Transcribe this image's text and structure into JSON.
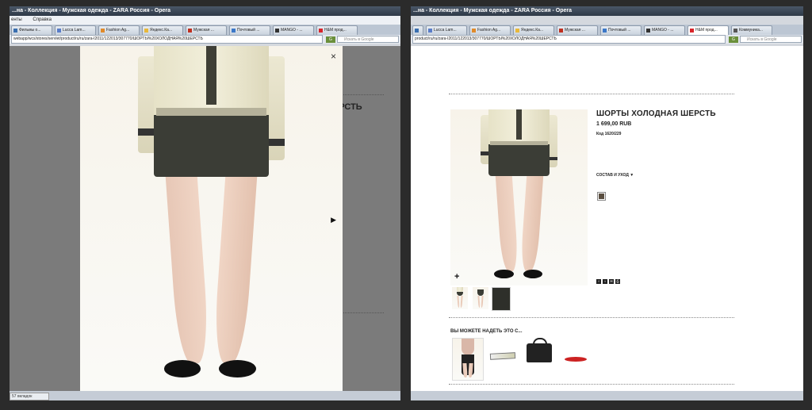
{
  "left_window": {
    "title": "...на - Коллекция - Мужская одежда - ZARA Россия - Opera",
    "menu": [
      "енты",
      "Справка"
    ],
    "tabs": [
      "Фильмы о...",
      "Lucca Lam...",
      "Fashion Ag...",
      "Яндекс.Ка...",
      "Мужская ...",
      "Почтовый ...",
      "MANGO - ...",
      "H&M прод..."
    ],
    "address": "webapp/wcs/stores/servlet/product/ru/ru/zara-I2011/122013/307770/ШОРТЫ%20ХОЛОДНАЯ%20ШЕРСТЬ",
    "search_placeholder": "Искать в Google",
    "status": "57 вкладок",
    "background_title_fragment": "ЕРСТЬ",
    "modal": {
      "close": "×",
      "next": "▶"
    }
  },
  "right_window": {
    "title": "...на - Коллекция - Мужская одежда - ZARA Россия - Opera",
    "tabs": [
      "",
      "Lucca Lam...",
      "Fashion Ag...",
      "Яндекс.Ка...",
      "Мужская ...",
      "Почтовый ...",
      "MANGO - ...",
      "H&M прод...",
      "Коммуника..."
    ],
    "address": "product/ru/ru/zara-I2011/122013/307770/ШОРТЫ%20ХОЛОДНАЯ%20ШЕРСТЬ",
    "search_placeholder": "Искать в Google",
    "product": {
      "title": "ШОРТЫ ХОЛОДНАЯ ШЕРСТЬ",
      "price": "1 699,00 RUB",
      "code": "Код 1620/229",
      "care": "СОСТАВ И УХОД ▼",
      "swatch_color": "#5a4e40"
    },
    "zoom": "+",
    "social": [
      "f",
      "t",
      "✉",
      "⎙"
    ],
    "also_title": "ВЫ МОЖЕТЕ НАДЕТЬ ЭТО С...",
    "accent": "#cc2222"
  }
}
